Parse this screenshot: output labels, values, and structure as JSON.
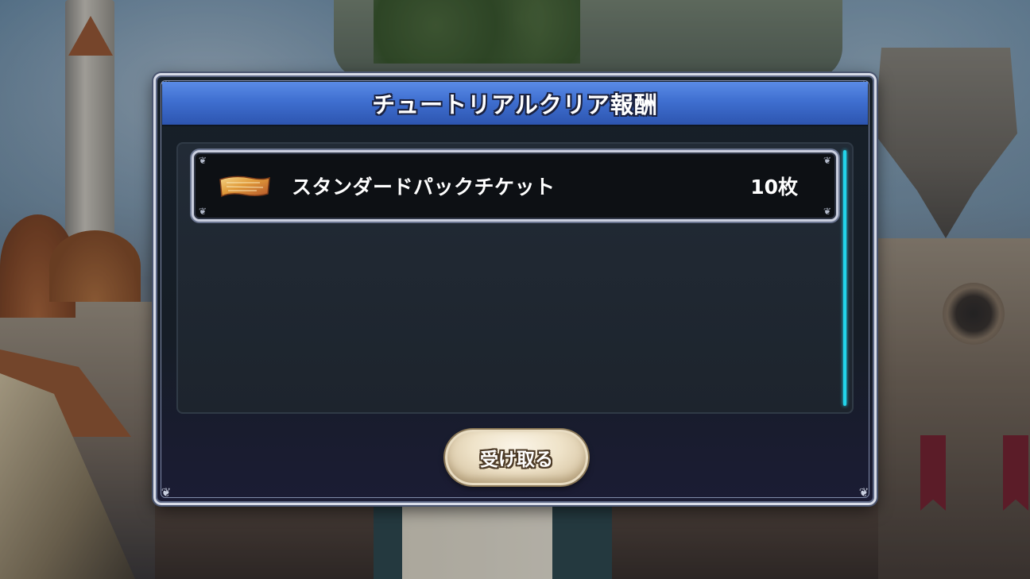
{
  "dialog": {
    "title": "チュートリアルクリア報酬"
  },
  "rewards": [
    {
      "icon": "ticket-icon",
      "name": "スタンダードパックチケット",
      "count": "10枚"
    }
  ],
  "actions": {
    "receive_label": "受け取る"
  },
  "colors": {
    "title_bar": "#3f6fd0",
    "scrollbar": "#22d4ea",
    "button_face": "#efe3c9",
    "frame": "#d8dce8"
  }
}
